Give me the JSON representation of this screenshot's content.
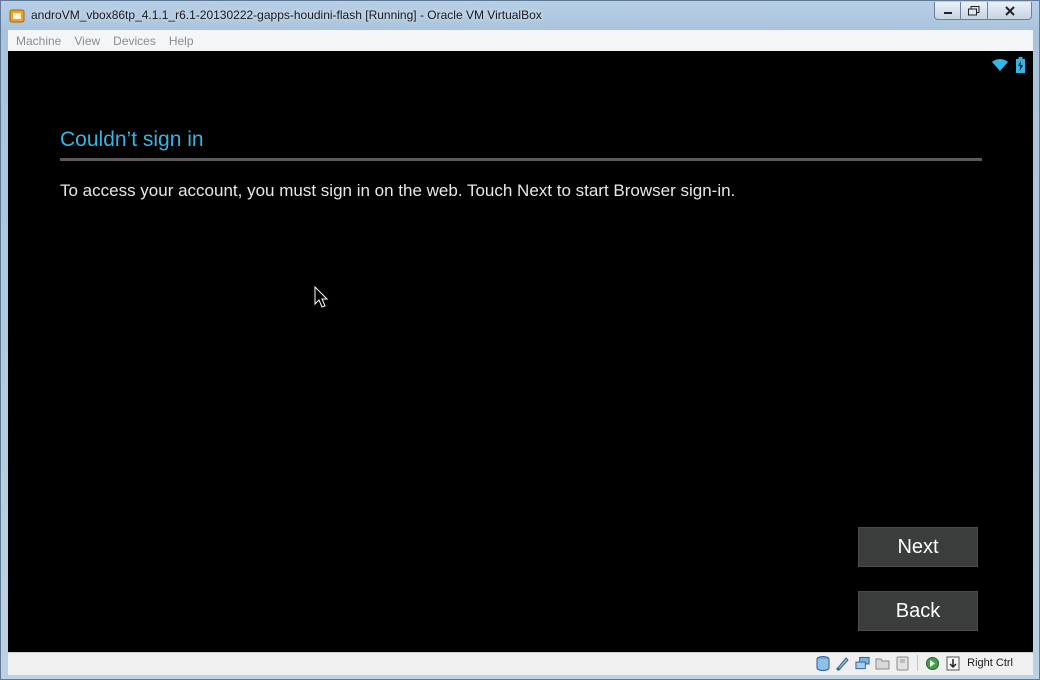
{
  "window": {
    "title": "androVM_vbox86tp_4.1.1_r6.1-20130222-gapps-houdini-flash [Running] - Oracle VM VirtualBox"
  },
  "menubar": {
    "items": [
      "Machine",
      "View",
      "Devices",
      "Help"
    ]
  },
  "guest": {
    "heading": "Couldn’t sign in",
    "message": "To access your account, you must sign in on the web. Touch Next to start Browser sign-in.",
    "next_label": "Next",
    "back_label": "Back",
    "status_icons": [
      "wifi-icon",
      "battery-charging-icon"
    ]
  },
  "statusbar": {
    "icons": [
      "hard-disk-icon",
      "optical-drive-icon",
      "network-icon",
      "shared-folders-icon",
      "usb-icon",
      "capture-icon",
      "mouse-integration-icon"
    ],
    "host_key": "Right Ctrl"
  },
  "colors": {
    "accent": "#33b5e5",
    "button_bg": "#3a3d3b",
    "screen_bg": "#000000"
  }
}
